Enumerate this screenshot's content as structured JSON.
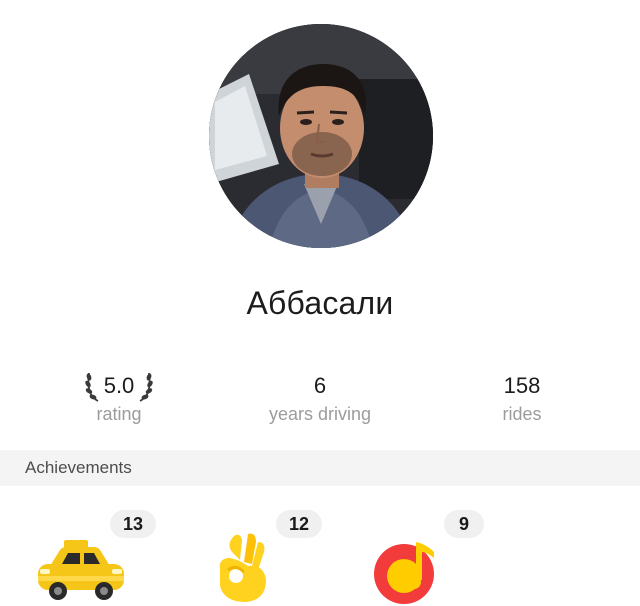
{
  "driver": {
    "name": "Аббасали"
  },
  "stats": {
    "rating": {
      "value": "5.0",
      "label": "rating"
    },
    "years": {
      "value": "6",
      "label": "years driving"
    },
    "rides": {
      "value": "158",
      "label": "rides"
    }
  },
  "achievements": {
    "title": "Achievements",
    "items": [
      {
        "count": "13",
        "icon": "taxi-car-icon"
      },
      {
        "count": "12",
        "icon": "ok-hand-icon"
      },
      {
        "count": "9",
        "icon": "music-note-icon"
      }
    ]
  },
  "colors": {
    "taxi_yellow": "#f5c518",
    "hand_yellow": "#ffd21f",
    "music_red": "#f23c3c",
    "label_gray": "#9c9c9c",
    "header_bg": "#f4f4f4"
  }
}
